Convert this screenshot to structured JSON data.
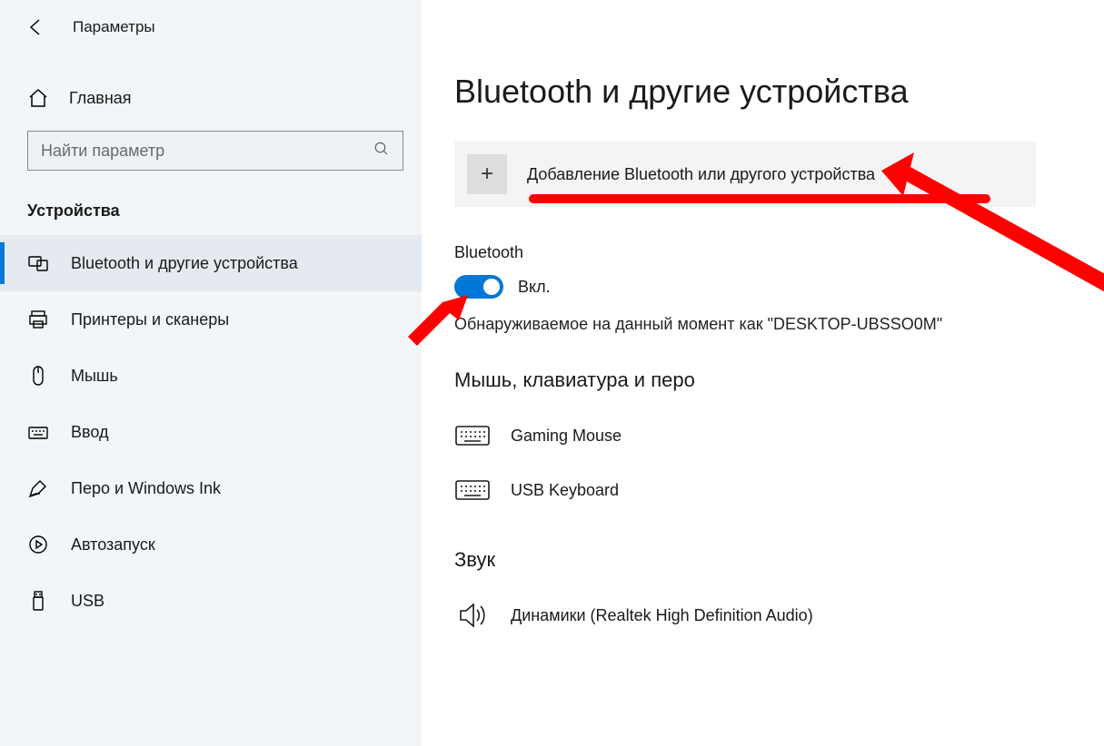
{
  "app": {
    "title": "Параметры"
  },
  "sidebar": {
    "home": "Главная",
    "search_placeholder": "Найти параметр",
    "section": "Устройства",
    "items": [
      {
        "label": "Bluetooth и другие устройства",
        "icon": "devices-icon",
        "active": true
      },
      {
        "label": "Принтеры и сканеры",
        "icon": "printer-icon",
        "active": false
      },
      {
        "label": "Мышь",
        "icon": "mouse-icon",
        "active": false
      },
      {
        "label": "Ввод",
        "icon": "typing-icon",
        "active": false
      },
      {
        "label": "Перо и Windows Ink",
        "icon": "pen-icon",
        "active": false
      },
      {
        "label": "Автозапуск",
        "icon": "autoplay-icon",
        "active": false
      },
      {
        "label": "USB",
        "icon": "usb-icon",
        "active": false
      }
    ]
  },
  "main": {
    "title": "Bluetooth и другие устройства",
    "add_device": "Добавление Bluetooth или другого устройства",
    "bt_section": "Bluetooth",
    "bt_toggle_state": "Вкл.",
    "discoverable": "Обнаруживаемое на данный момент как \"DESKTOP-UBSSO0M\"",
    "cat_mouse_kb": "Мышь, клавиатура и перо",
    "devices_mk": [
      {
        "name": "Gaming Mouse",
        "icon": "keyboard-icon"
      },
      {
        "name": "USB Keyboard",
        "icon": "keyboard-icon"
      }
    ],
    "cat_sound": "Звук",
    "devices_sound": [
      {
        "name": "Динамики (Realtek High Definition Audio)",
        "icon": "speaker-icon"
      }
    ]
  }
}
